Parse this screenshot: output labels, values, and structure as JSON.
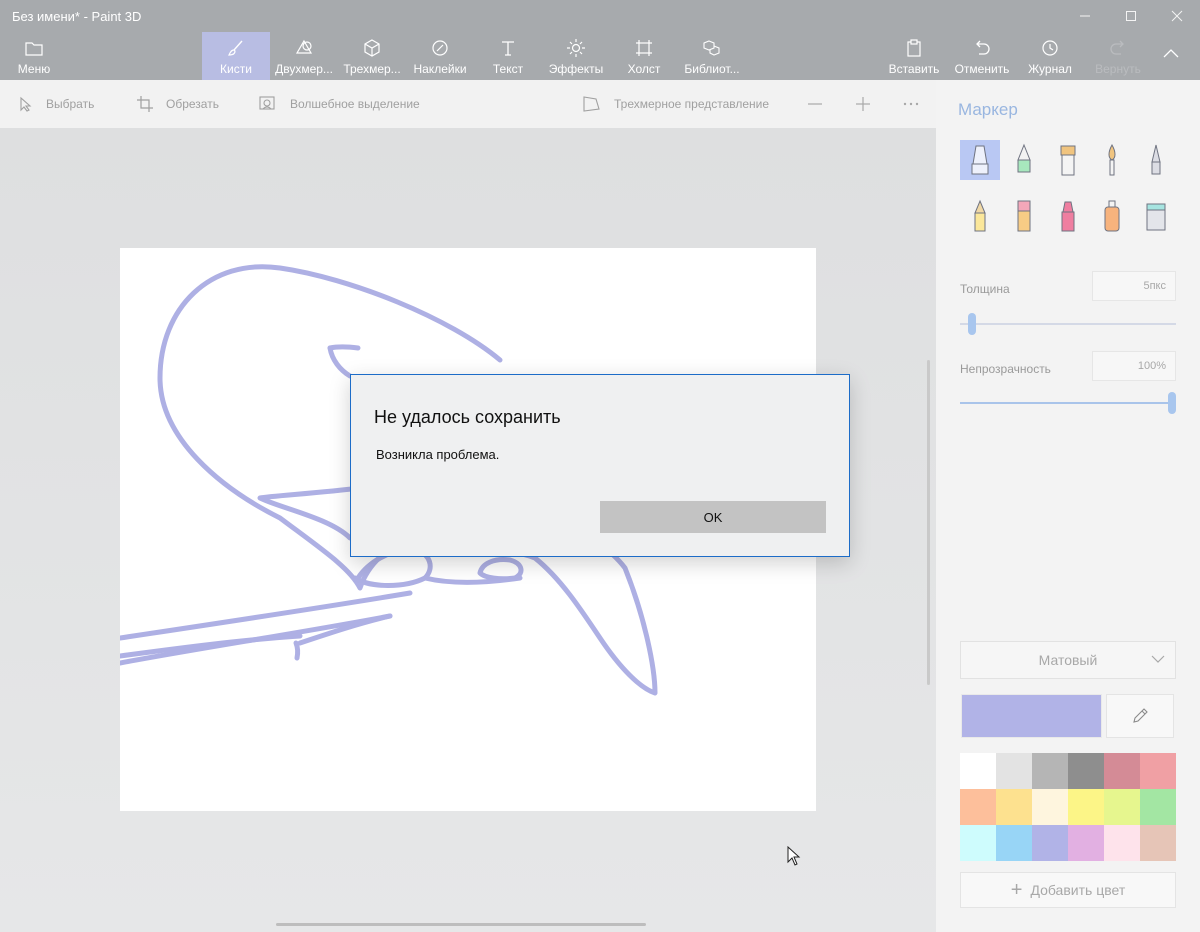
{
  "window": {
    "title": "Без имени* - Paint 3D",
    "controls": [
      "minimize",
      "maximize",
      "close"
    ]
  },
  "ribbon": {
    "menu_label": "Меню",
    "items": [
      {
        "label": "Кисти",
        "icon": "brush-icon",
        "active": true
      },
      {
        "label": "Двухмер...",
        "icon": "shapes-2d-icon"
      },
      {
        "label": "Трехмер...",
        "icon": "cube-icon"
      },
      {
        "label": "Наклейки",
        "icon": "sticker-icon"
      },
      {
        "label": "Текст",
        "icon": "text-icon"
      },
      {
        "label": "Эффекты",
        "icon": "effects-icon"
      },
      {
        "label": "Холст",
        "icon": "canvas-icon"
      },
      {
        "label": "Библиот...",
        "icon": "library-icon"
      }
    ],
    "right_items": [
      {
        "label": "Вставить",
        "icon": "paste-icon"
      },
      {
        "label": "Отменить",
        "icon": "undo-icon"
      },
      {
        "label": "Журнал",
        "icon": "history-icon"
      },
      {
        "label": "Вернуть",
        "icon": "redo-icon",
        "disabled": true
      }
    ]
  },
  "toolbar": {
    "select": "Выбрать",
    "crop": "Обрезать",
    "magic_select": "Волшебное выделение",
    "view_3d": "Трехмерное представление"
  },
  "dialog": {
    "title": "Не удалось сохранить",
    "message": "Возникла проблема.",
    "ok": "OK"
  },
  "panel": {
    "title": "Маркер",
    "brushes": [
      "marker-icon",
      "calligraphy-pen-icon",
      "oil-brush-icon",
      "watercolor-icon",
      "pixel-pen-icon",
      "pencil-icon",
      "eraser-icon",
      "crayon-icon",
      "spray-can-icon",
      "fill-bucket-icon"
    ],
    "thickness_label": "Толщина",
    "thickness_value": "5пкс",
    "thickness_level": 0.05,
    "opacity_label": "Непрозрачность",
    "opacity_value": "100%",
    "opacity_level": 1.0,
    "finish": "Матовый",
    "current_color": "#b1b3e7",
    "palette": [
      "#ffffff",
      "#e3e3e3",
      "#b5b5b5",
      "#8e8e8e",
      "#d48b96",
      "#f0a0a4",
      "#fdbf9b",
      "#fde18f",
      "#fef5de",
      "#fcf587",
      "#e6f68e",
      "#a3e6a3",
      "#cefcfd",
      "#98d5f6",
      "#b1b3e7",
      "#e2b0e2",
      "#fee3eb",
      "#e6c5b7"
    ],
    "add_color": "Добавить цвет"
  }
}
